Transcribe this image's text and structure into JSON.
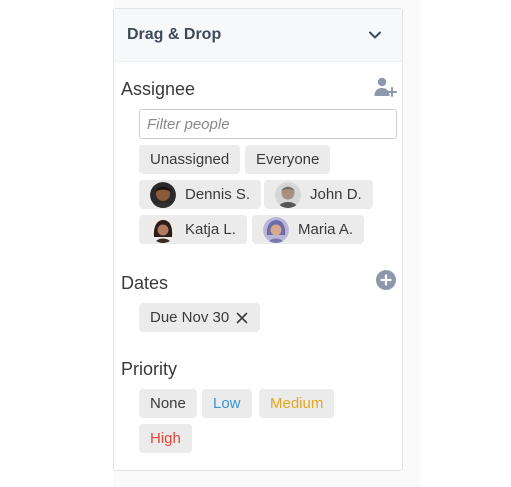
{
  "panel": {
    "title": "Drag & Drop",
    "collapse_icon": "chevron-down-icon"
  },
  "assignee": {
    "title": "Assignee",
    "add_icon": "add-person-icon",
    "filter_placeholder": "Filter people",
    "filter_value": "",
    "options": [
      "Unassigned",
      "Everyone"
    ],
    "people": [
      {
        "name": "Dennis S.",
        "avatar_color": "#4a3a30"
      },
      {
        "name": "John D.",
        "avatar_color": "#8a8a8a"
      },
      {
        "name": "Katja L.",
        "avatar_color": "#5a3e3a"
      },
      {
        "name": "Maria A.",
        "avatar_color": "#8a84b8"
      }
    ]
  },
  "dates": {
    "title": "Dates",
    "add_icon": "add-circle-icon",
    "chip": "Due Nov 30",
    "remove_icon": "close-icon"
  },
  "priority": {
    "title": "Priority",
    "options": [
      {
        "label": "None",
        "color": "#3a3a3a"
      },
      {
        "label": "Low",
        "color": "#3a93d8"
      },
      {
        "label": "Medium",
        "color": "#e0a820"
      },
      {
        "label": "High",
        "color": "#e0473a"
      }
    ]
  },
  "colors": {
    "chip_bg": "#ebebeb",
    "header_title": "#3d4a5c",
    "add_icon": "#8e98ad"
  }
}
